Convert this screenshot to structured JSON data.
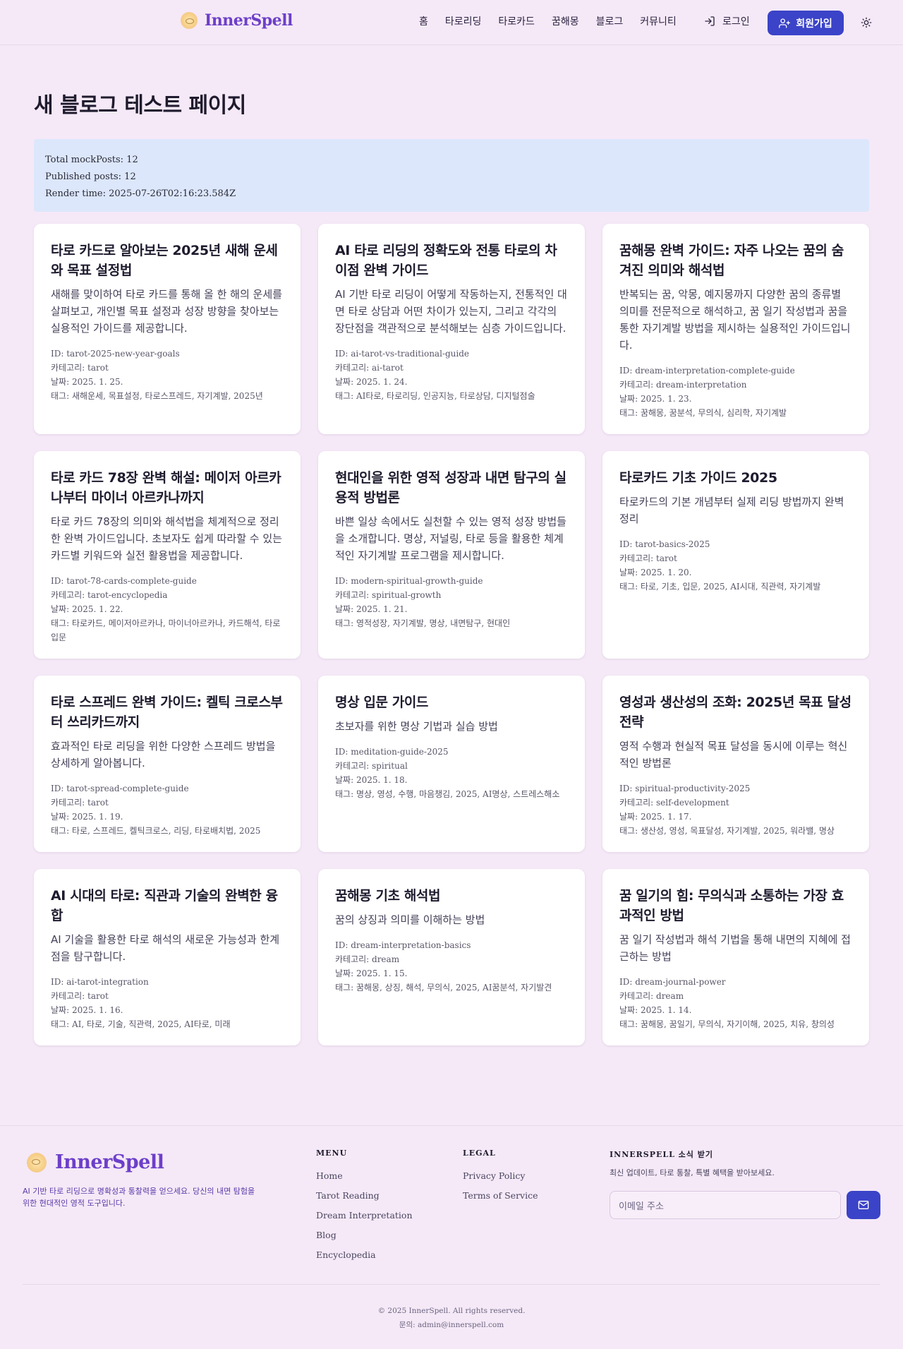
{
  "header": {
    "brand": "InnerSpell",
    "nav": [
      "홈",
      "타로리딩",
      "타로카드",
      "꿈해몽",
      "블로그",
      "커뮤니티"
    ],
    "login_label": "로그인",
    "signup_label": "회원가입"
  },
  "main": {
    "title": "새 블로그 테스트 페이지",
    "debug": {
      "total": "Total mockPosts: 12",
      "published": "Published posts: 12",
      "render": "Render time: 2025-07-26T02:16:23.584Z"
    },
    "posts": [
      {
        "title": "타로 카드로 알아보는 2025년 새해 운세와 목표 설정법",
        "desc": "새해를 맞이하여 타로 카드를 통해 올 한 해의 운세를 살펴보고, 개인별 목표 설정과 성장 방향을 찾아보는 실용적인 가이드를 제공합니다.",
        "id": "ID: tarot-2025-new-year-goals",
        "category": "카테고리: tarot",
        "date": "날짜: 2025. 1. 25.",
        "tags": "태그: 새해운세, 목표설정, 타로스프레드, 자기계발, 2025년"
      },
      {
        "title": "AI 타로 리딩의 정확도와 전통 타로의 차이점 완벽 가이드",
        "desc": "AI 기반 타로 리딩이 어떻게 작동하는지, 전통적인 대면 타로 상담과 어떤 차이가 있는지, 그리고 각각의 장단점을 객관적으로 분석해보는 심층 가이드입니다.",
        "id": "ID: ai-tarot-vs-traditional-guide",
        "category": "카테고리: ai-tarot",
        "date": "날짜: 2025. 1. 24.",
        "tags": "태그: AI타로, 타로리딩, 인공지능, 타로상담, 디지털점술"
      },
      {
        "title": "꿈해몽 완벽 가이드: 자주 나오는 꿈의 숨겨진 의미와 해석법",
        "desc": "반복되는 꿈, 악몽, 예지몽까지 다양한 꿈의 종류별 의미를 전문적으로 해석하고, 꿈 일기 작성법과 꿈을 통한 자기계발 방법을 제시하는 실용적인 가이드입니다.",
        "id": "ID: dream-interpretation-complete-guide",
        "category": "카테고리: dream-interpretation",
        "date": "날짜: 2025. 1. 23.",
        "tags": "태그: 꿈해몽, 꿈분석, 무의식, 심리학, 자기계발"
      },
      {
        "title": "타로 카드 78장 완벽 해설: 메이저 아르카나부터 마이너 아르카나까지",
        "desc": "타로 카드 78장의 의미와 해석법을 체계적으로 정리한 완벽 가이드입니다. 초보자도 쉽게 따라할 수 있는 카드별 키워드와 실전 활용법을 제공합니다.",
        "id": "ID: tarot-78-cards-complete-guide",
        "category": "카테고리: tarot-encyclopedia",
        "date": "날짜: 2025. 1. 22.",
        "tags": "태그: 타로카드, 메이저아르카나, 마이너아르카나, 카드해석, 타로입문"
      },
      {
        "title": "현대인을 위한 영적 성장과 내면 탐구의 실용적 방법론",
        "desc": "바쁜 일상 속에서도 실천할 수 있는 영적 성장 방법들을 소개합니다. 명상, 저널링, 타로 등을 활용한 체계적인 자기계발 프로그램을 제시합니다.",
        "id": "ID: modern-spiritual-growth-guide",
        "category": "카테고리: spiritual-growth",
        "date": "날짜: 2025. 1. 21.",
        "tags": "태그: 영적성장, 자기계발, 명상, 내면탐구, 현대인"
      },
      {
        "title": "타로카드 기초 가이드 2025",
        "desc": "타로카드의 기본 개념부터 실제 리딩 방법까지 완벽 정리",
        "id": "ID: tarot-basics-2025",
        "category": "카테고리: tarot",
        "date": "날짜: 2025. 1. 20.",
        "tags": "태그: 타로, 기초, 입문, 2025, AI시대, 직관력, 자기계발"
      },
      {
        "title": "타로 스프레드 완벽 가이드: 켈틱 크로스부터 쓰리카드까지",
        "desc": "효과적인 타로 리딩을 위한 다양한 스프레드 방법을 상세하게 알아봅니다.",
        "id": "ID: tarot-spread-complete-guide",
        "category": "카테고리: tarot",
        "date": "날짜: 2025. 1. 19.",
        "tags": "태그: 타로, 스프레드, 켈틱크로스, 리딩, 타로배치법, 2025"
      },
      {
        "title": "명상 입문 가이드",
        "desc": "초보자를 위한 명상 기법과 실습 방법",
        "id": "ID: meditation-guide-2025",
        "category": "카테고리: spiritual",
        "date": "날짜: 2025. 1. 18.",
        "tags": "태그: 명상, 영성, 수행, 마음챙김, 2025, AI명상, 스트레스해소"
      },
      {
        "title": "영성과 생산성의 조화: 2025년 목표 달성 전략",
        "desc": "영적 수행과 현실적 목표 달성을 동시에 이루는 혁신적인 방법론",
        "id": "ID: spiritual-productivity-2025",
        "category": "카테고리: self-development",
        "date": "날짜: 2025. 1. 17.",
        "tags": "태그: 생산성, 영성, 목표달성, 자기계발, 2025, 워라밸, 명상"
      },
      {
        "title": "AI 시대의 타로: 직관과 기술의 완벽한 융합",
        "desc": "AI 기술을 활용한 타로 해석의 새로운 가능성과 한계점을 탐구합니다.",
        "id": "ID: ai-tarot-integration",
        "category": "카테고리: tarot",
        "date": "날짜: 2025. 1. 16.",
        "tags": "태그: AI, 타로, 기술, 직관력, 2025, AI타로, 미래"
      },
      {
        "title": "꿈해몽 기초 해석법",
        "desc": "꿈의 상징과 의미를 이해하는 방법",
        "id": "ID: dream-interpretation-basics",
        "category": "카테고리: dream",
        "date": "날짜: 2025. 1. 15.",
        "tags": "태그: 꿈해몽, 상징, 해석, 무의식, 2025, AI꿈분석, 자기발견"
      },
      {
        "title": "꿈 일기의 힘: 무의식과 소통하는 가장 효과적인 방법",
        "desc": "꿈 일기 작성법과 해석 기법을 통해 내면의 지혜에 접근하는 방법",
        "id": "ID: dream-journal-power",
        "category": "카테고리: dream",
        "date": "날짜: 2025. 1. 14.",
        "tags": "태그: 꿈해몽, 꿈일기, 무의식, 자기이해, 2025, 치유, 창의성"
      }
    ]
  },
  "footer": {
    "brand": "InnerSpell",
    "tagline": "AI 기반 타로 리딩으로 명확성과 통찰력을 얻으세요. 당신의 내면 탐험을 위한 현대적인 영적 도구입니다.",
    "menu_head": "MENU",
    "menu": [
      "Home",
      "Tarot Reading",
      "Dream Interpretation",
      "Blog",
      "Encyclopedia"
    ],
    "legal_head": "LEGAL",
    "legal": [
      "Privacy Policy",
      "Terms of Service"
    ],
    "news_head": "INNERSPELL 소식 받기",
    "news_desc": "최신 업데이트, 타로 통찰, 특별 혜택을 받아보세요.",
    "email_placeholder": "이메일 주소",
    "copyright": "© 2025 InnerSpell. All rights reserved.",
    "contact": "문의: admin@innerspell.com"
  }
}
